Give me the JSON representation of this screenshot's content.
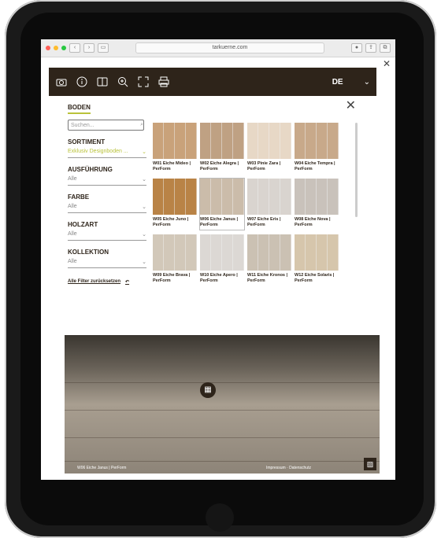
{
  "browser": {
    "url": "tarkuerne.com"
  },
  "toolbar": {
    "language": "DE"
  },
  "panel": {
    "tab_label": "BODEN"
  },
  "sidebar": {
    "search_placeholder": "Suchen...",
    "groups": [
      {
        "title": "SORTIMENT",
        "value": "Exklusiv Designboden ..."
      },
      {
        "title": "AUSFÜHRUNG",
        "value": "Alle"
      },
      {
        "title": "FARBE",
        "value": "Alle"
      },
      {
        "title": "HOLZART",
        "value": "Alle"
      },
      {
        "title": "KOLLEKTION",
        "value": "Alle"
      }
    ],
    "reset_label": "Alle Filter zurücksetzen"
  },
  "products": [
    {
      "label": "W01 Eiche Mideo | PerForm",
      "color": "#c9a27a"
    },
    {
      "label": "W02 Eiche Alegra | PerForm",
      "color": "#bfa183"
    },
    {
      "label": "W03 Pinie Zara | PerForm",
      "color": "#e7d8c6"
    },
    {
      "label": "W04 Eiche Tempra | PerForm",
      "color": "#c8a98a"
    },
    {
      "label": "W05 Eiche Juno | PerForm",
      "color": "#b98346"
    },
    {
      "label": "W06 Eiche Janus | PerForm",
      "color": "#cbbcaa"
    },
    {
      "label": "W07 Eiche Eris | PerForm",
      "color": "#d9d4cf"
    },
    {
      "label": "W08 Eiche Nova | PerForm",
      "color": "#c9c2bb"
    },
    {
      "label": "W09 Eiche Brava | PerForm",
      "color": "#d2c8b9"
    },
    {
      "label": "W10 Eiche Apero | PerForm",
      "color": "#dcd8d4"
    },
    {
      "label": "W11 Eiche Kronos | PerForm",
      "color": "#cbc1b3"
    },
    {
      "label": "W12 Eiche Solaris | PerForm",
      "color": "#d6c6ac"
    }
  ],
  "footer": {
    "selected_product": "W06 Eiche Janus | PerForm",
    "links": "Impressum · Datenschutz"
  }
}
